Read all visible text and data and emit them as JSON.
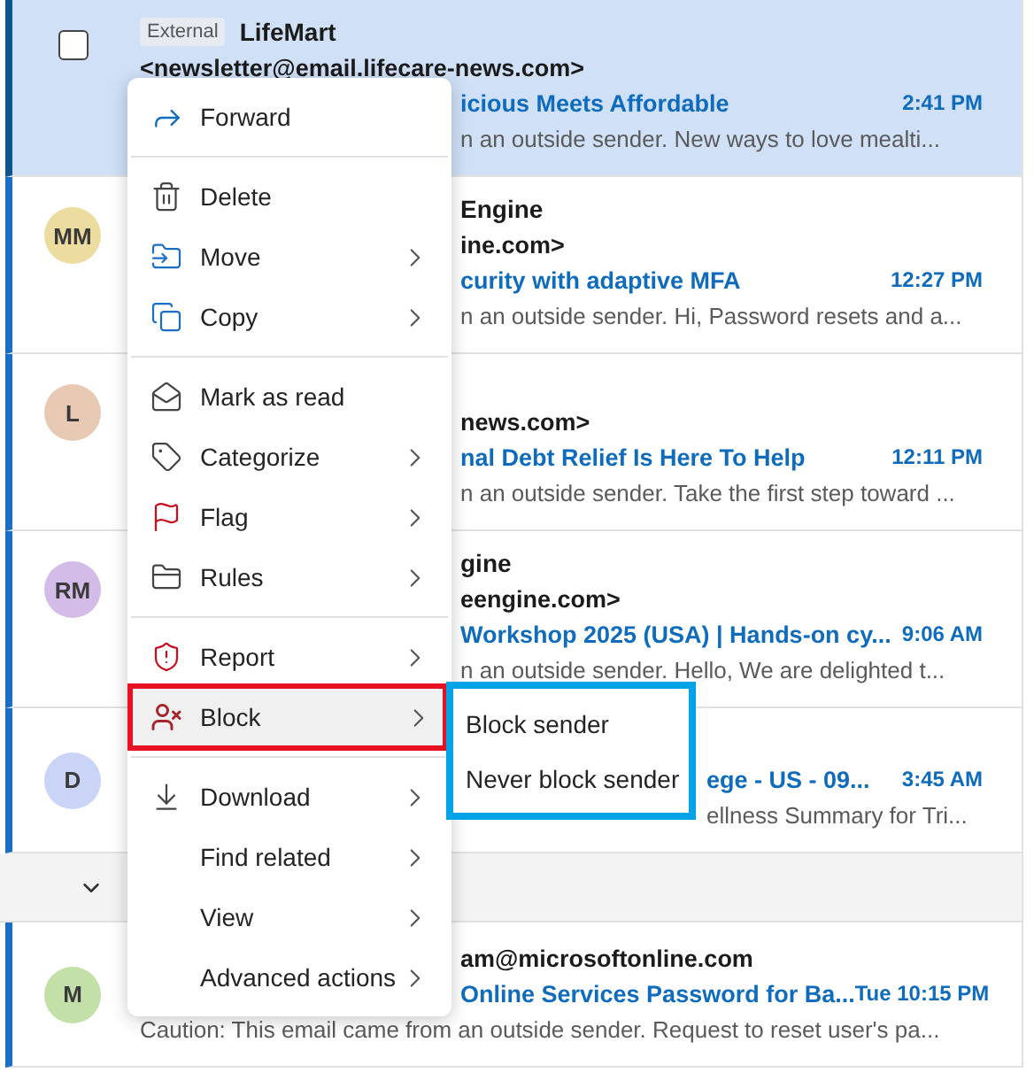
{
  "messages": [
    {
      "kind": "standard",
      "selected": true,
      "lines": [
        {
          "kind": "sender",
          "tag": "External",
          "text": "LifeMart"
        },
        {
          "kind": "email",
          "text": "<newsletter@email.lifecare-news.com>"
        },
        {
          "kind": "subject",
          "text": "icious Meets Affordable",
          "time": "2:41 PM",
          "hidden_start": true
        },
        {
          "kind": "preview",
          "text": "n an outside sender. New ways to love mealti...",
          "hidden_start": true
        }
      ]
    },
    {
      "kind": "standard",
      "selected": false,
      "avatar": {
        "initials": "MM",
        "color": "#ecdca0"
      },
      "lines": [
        {
          "kind": "sender",
          "text": "Engine",
          "hidden_start": true
        },
        {
          "kind": "email",
          "text": "ine.com>",
          "hidden_start": true
        },
        {
          "kind": "subject",
          "text": "curity with adaptive MFA",
          "time": "12:27 PM",
          "hidden_start": true
        },
        {
          "kind": "preview",
          "text": "n an outside sender. Hi, Password resets and a...",
          "hidden_start": true
        }
      ]
    },
    {
      "kind": "standard",
      "selected": false,
      "avatar": {
        "initials": "L",
        "color": "#e8c9b3"
      },
      "lines": [
        {
          "kind": "email",
          "text": "news.com>",
          "hidden_start": true
        },
        {
          "kind": "subject",
          "text": "nal Debt Relief Is Here To Help",
          "time": "12:11 PM",
          "hidden_start": true
        },
        {
          "kind": "preview",
          "text": "n an outside sender. Take the first step toward ...",
          "hidden_start": true
        }
      ]
    },
    {
      "kind": "standard",
      "selected": false,
      "avatar": {
        "initials": "RM",
        "color": "#d3bde8"
      },
      "lines": [
        {
          "kind": "sender",
          "text": "gine",
          "hidden_start": true
        },
        {
          "kind": "email",
          "text": "eengine.com>",
          "hidden_start": true
        },
        {
          "kind": "subject",
          "text": "Workshop 2025 (USA) | Hands-on cy...",
          "time": "9:06 AM",
          "hidden_start": true
        },
        {
          "kind": "preview",
          "text": "n an outside sender. Hello, We are delighted t...",
          "hidden_start": true
        }
      ]
    },
    {
      "kind": "compact",
      "selected": false,
      "avatar": {
        "initials": "D",
        "color": "#c9d4f7"
      },
      "lines": [
        {
          "kind": "subject",
          "text": "ege - US - 09...",
          "time": "3:45 AM",
          "hidden_start": true,
          "behind_submenu": true
        },
        {
          "kind": "preview",
          "text": "ellness Summary for Tri...",
          "hidden_start": true,
          "behind_submenu": true
        }
      ]
    },
    {
      "kind": "group",
      "expanded": true
    },
    {
      "kind": "compact",
      "selected": false,
      "avatar": {
        "initials": "M",
        "color": "#c3e0a8"
      },
      "lines": [
        {
          "kind": "email",
          "text": "am@microsoftonline.com",
          "hidden_start": true
        },
        {
          "kind": "subject",
          "text": "Online Services Password for Ba...",
          "time": "Tue 10:15 PM",
          "hidden_start": true
        },
        {
          "kind": "preview",
          "text": "Caution: This email came from an outside sender. Request to reset user's pa..."
        }
      ]
    }
  ],
  "context_menu": {
    "sections": [
      [
        {
          "label": "Forward",
          "submenu": false,
          "highlighted": false
        }
      ],
      [
        {
          "label": "Delete",
          "submenu": false,
          "highlighted": false
        },
        {
          "label": "Move",
          "submenu": true,
          "highlighted": false
        },
        {
          "label": "Copy",
          "submenu": true,
          "highlighted": false
        }
      ],
      [
        {
          "label": "Mark as read",
          "submenu": false,
          "highlighted": false
        },
        {
          "label": "Categorize",
          "submenu": true,
          "highlighted": false
        },
        {
          "label": "Flag",
          "submenu": true,
          "highlighted": false
        },
        {
          "label": "Rules",
          "submenu": true,
          "highlighted": false
        }
      ],
      [
        {
          "label": "Report",
          "submenu": true,
          "highlighted": false
        },
        {
          "label": "Block",
          "submenu": true,
          "highlighted": true
        }
      ],
      [
        {
          "label": "Download",
          "submenu": true,
          "highlighted": false
        },
        {
          "label": "Find related",
          "submenu": true,
          "highlighted": false
        },
        {
          "label": "View",
          "submenu": true,
          "highlighted": false
        },
        {
          "label": "Advanced actions",
          "submenu": true,
          "highlighted": false
        }
      ]
    ]
  },
  "submenu": {
    "items": [
      "Block sender",
      "Never block sender"
    ]
  }
}
